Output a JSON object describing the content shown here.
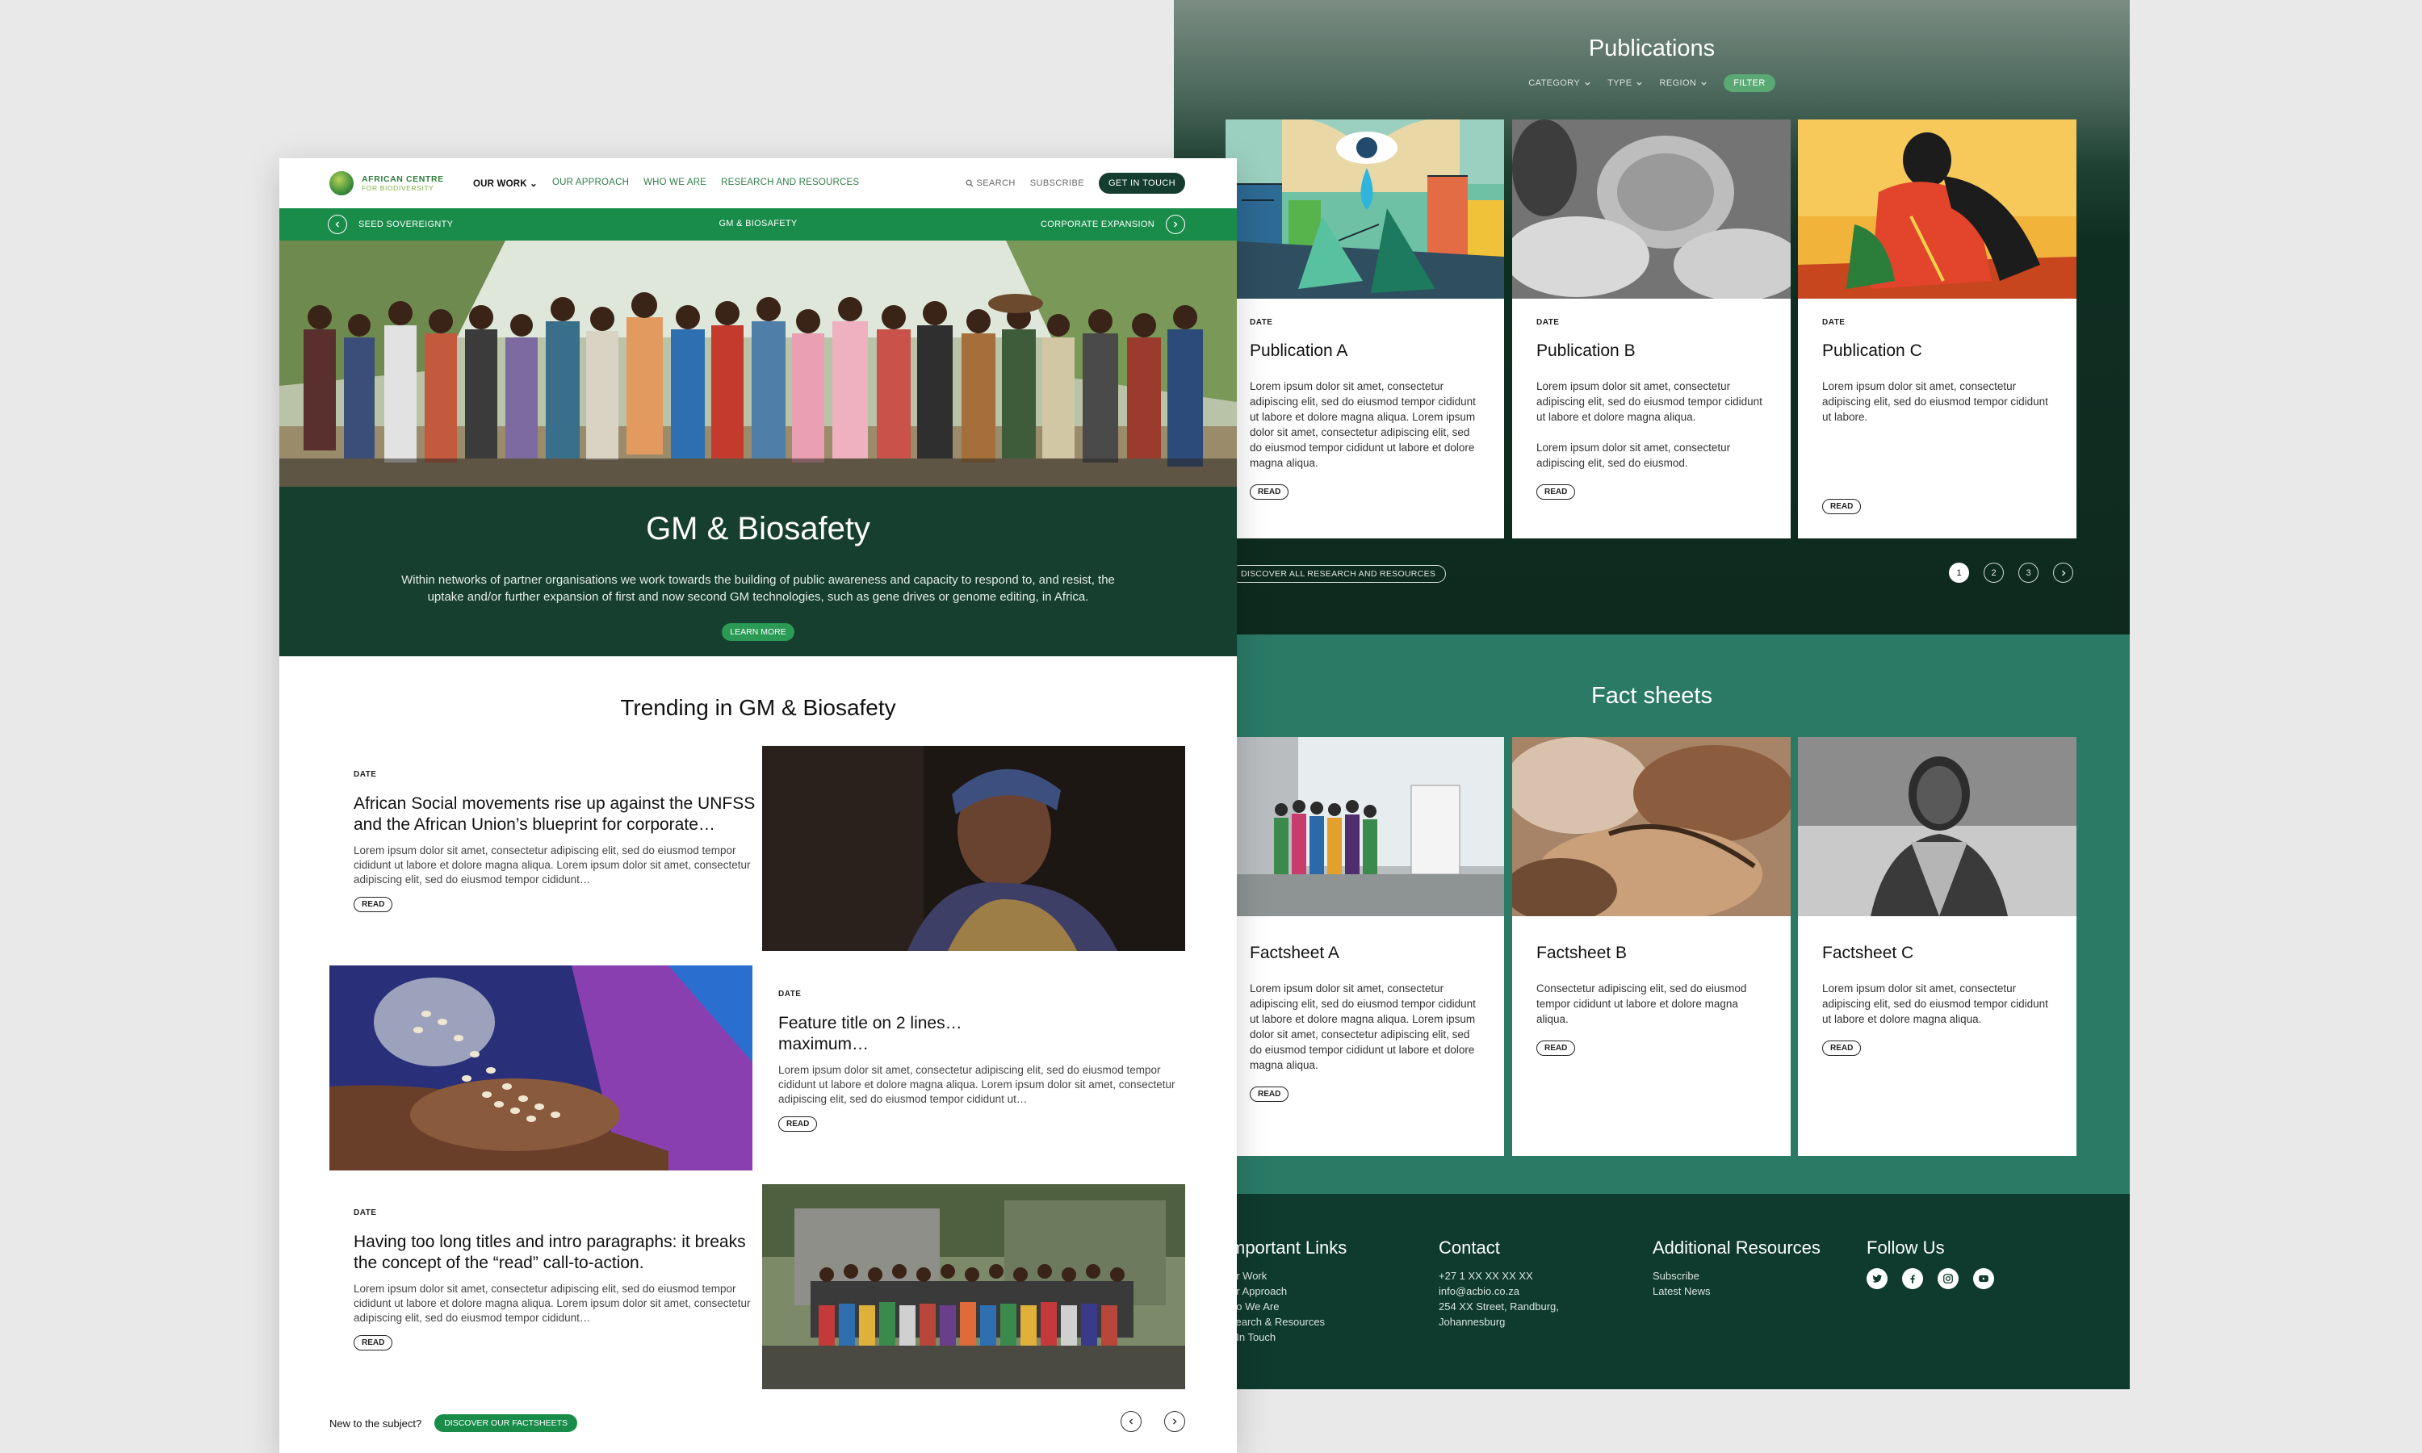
{
  "right_page": {
    "publications": {
      "title": "Publications",
      "filters": [
        "CATEGORY",
        "TYPE",
        "REGION"
      ],
      "filter_button": "FILTER",
      "cards": [
        {
          "date": "DATE",
          "title": "Publication A",
          "text": "Lorem ipsum dolor sit amet, consectetur adipiscing elit, sed do eiusmod tempor cididunt ut labore et dolore magna aliqua. Lorem ipsum dolor sit amet, consectetur adipiscing elit, sed do eiusmod tempor cididunt ut labore et dolore magna aliqua.",
          "read": "READ"
        },
        {
          "date": "DATE",
          "title": "Publication B",
          "text": "Lorem ipsum dolor sit amet, consectetur adipiscing elit, sed do eiusmod tempor cididunt ut labore et dolore magna aliqua.",
          "text2": "Lorem ipsum dolor sit amet, consectetur adipiscing elit, sed do eiusmod.",
          "read": "READ"
        },
        {
          "date": "DATE",
          "title": "Publication C",
          "text": "Lorem ipsum dolor sit amet, consectetur adipiscing elit, sed do eiusmod tempor cididunt ut labore.",
          "read": "READ"
        }
      ],
      "discover_all": "DISCOVER ALL RESEARCH AND RESOURCES",
      "pages": [
        "1",
        "2",
        "3"
      ]
    },
    "fact_sheets": {
      "title": "Fact sheets",
      "cards": [
        {
          "title": "Factsheet A",
          "text": "Lorem ipsum dolor sit amet, consectetur adipiscing elit, sed do eiusmod tempor cididunt ut labore et dolore magna aliqua. Lorem ipsum dolor sit amet, consectetur adipiscing elit, sed do eiusmod tempor cididunt ut labore et dolore magna aliqua.",
          "read": "READ"
        },
        {
          "title": "Factsheet B",
          "text": "Consectetur adipiscing elit, sed do eiusmod tempor cididunt ut labore et dolore magna aliqua.",
          "read": "READ"
        },
        {
          "title": "Factsheet C",
          "text": "Lorem ipsum dolor sit amet, consectetur adipiscing elit, sed do eiusmod tempor cididunt ut labore et dolore magna aliqua.",
          "read": "READ"
        }
      ]
    },
    "footer": {
      "links_title": "mportant Links",
      "links": [
        "ur Work",
        "ur Approach",
        "ho We Are",
        "search & Resources",
        "t In Touch"
      ],
      "contact_title": "Contact",
      "contact": [
        "+27 1 XX XX XX XX",
        "info@acbio.co.za",
        "254 XX Street, Randburg,",
        "Johannesburg"
      ],
      "resources_title": "Additional Resources",
      "resources": [
        "Subscribe",
        "Latest News"
      ],
      "follow_title": "Follow Us",
      "social_icons": [
        "twitter-icon",
        "facebook-icon",
        "instagram-icon",
        "youtube-icon"
      ]
    }
  },
  "left_page": {
    "logo": {
      "line1": "AFRICAN CENTRE",
      "line2": "FOR BIODIVERSITY"
    },
    "menu": [
      "OUR WORK",
      "OUR APPROACH",
      "WHO WE ARE",
      "RESEARCH AND RESOURCES"
    ],
    "search": "SEARCH",
    "subscribe": "SUBSCRIBE",
    "cta": "GET IN TOUCH",
    "subnav": {
      "prev": "SEED SOVEREIGNTY",
      "current": "GM & BIOSAFETY",
      "next": "CORPORATE EXPANSION"
    },
    "hero": {
      "title": "GM & Biosafety",
      "text": "Within networks of partner organisations we work towards the building of public awareness and capacity to respond to, and resist, the uptake and/or further expansion of first and now second GM technologies, such as gene drives or genome editing, in Africa.",
      "button": "LEARN MORE"
    },
    "trending_title": "Trending in GM & Biosafety",
    "features": [
      {
        "date": "DATE",
        "title": "African Social movements rise up against the UNFSS and the African Union’s blueprint for corporate…",
        "text": "Lorem ipsum dolor sit amet, consectetur adipiscing elit, sed do eiusmod tempor cididunt ut labore et dolore magna aliqua. Lorem ipsum dolor sit amet, consectetur adipiscing elit, sed do eiusmod tempor cididunt…",
        "read": "READ"
      },
      {
        "date": "DATE",
        "title": "Feature title on 2 lines… maximum…",
        "text": "Lorem ipsum dolor sit amet, consectetur adipiscing elit, sed do eiusmod tempor cididunt ut labore et dolore magna aliqua. Lorem ipsum dolor sit amet, consectetur adipiscing elit, sed do eiusmod tempor cididunt ut…",
        "read": "READ"
      },
      {
        "date": "DATE",
        "title": "Having too long titles and intro paragraphs: it breaks the concept of the “read” call-to-action.",
        "text": "Lorem ipsum dolor sit amet, consectetur adipiscing elit, sed do eiusmod tempor cididunt ut labore et dolore magna aliqua. Lorem ipsum dolor sit amet, consectetur adipiscing elit, sed do eiusmod tempor cididunt…",
        "read": "READ"
      }
    ],
    "bottom": {
      "label": "New to the subject?",
      "button": "DISCOVER OUR FACTSHEETS"
    }
  },
  "colors": {
    "dark_green": "#163f30",
    "brand_green": "#1a8c4a",
    "teal": "#2a7a66",
    "background": "#e9e9e9"
  }
}
